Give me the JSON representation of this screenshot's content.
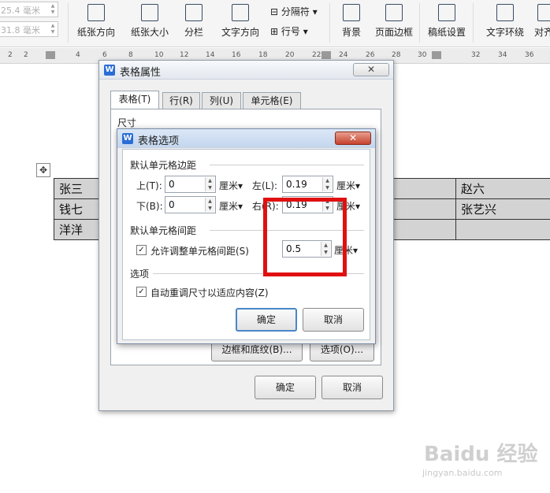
{
  "ribbon": {
    "width_field": "25.4 毫米",
    "height_field": "31.8 毫米",
    "buttons": [
      "纸张方向",
      "纸张大小",
      "分栏",
      "文字方向",
      "背景",
      "页面边框",
      "稿纸设置",
      "文字环绕",
      "对齐"
    ],
    "separator_btn": "分隔符",
    "line_num_btn": "行号"
  },
  "ruler": {
    "ticks": [
      "2",
      "2",
      "4",
      "6",
      "8",
      "10",
      "12",
      "14",
      "16",
      "18",
      "20",
      "22",
      "24",
      "26",
      "28",
      "30",
      "32",
      "34",
      "36"
    ]
  },
  "document": {
    "rows": [
      [
        "张三",
        "",
        "赵六"
      ],
      [
        "钱七",
        "",
        "张艺兴"
      ],
      [
        "洋洋",
        "",
        ""
      ]
    ]
  },
  "outer_dialog": {
    "title": "表格属性",
    "close": "✕",
    "tabs": [
      "表格(T)",
      "行(R)",
      "列(U)",
      "单元格(E)"
    ],
    "section_size": "尺寸",
    "border_shading_btn": "边框和底纹(B)...",
    "options_btn": "选项(O)...",
    "ok": "确定",
    "cancel": "取消"
  },
  "inner_dialog": {
    "title": "表格选项",
    "close": "✕",
    "section_margins": "默认单元格边距",
    "top_label": "上(T):",
    "top_value": "0",
    "bottom_label": "下(B):",
    "bottom_value": "0",
    "left_label": "左(L):",
    "left_value": "0.19",
    "right_label": "右(R):",
    "right_value": "0.19",
    "unit": "厘米▾",
    "section_spacing": "默认单元格间距",
    "allow_spacing_label": "允许调整单元格间距(S)",
    "spacing_value": "0.5",
    "section_options": "选项",
    "autofit_label": "自动重调尺寸以适应内容(Z)",
    "ok": "确定",
    "cancel": "取消"
  },
  "watermark": {
    "logo": "Baidu 经验",
    "url": "jingyan.baidu.com"
  },
  "colors": {
    "highlight": "#e01010",
    "table_fill": "#d3d3d3",
    "close_red": "#c6402d",
    "wps_blue": "#2b6dd6"
  }
}
